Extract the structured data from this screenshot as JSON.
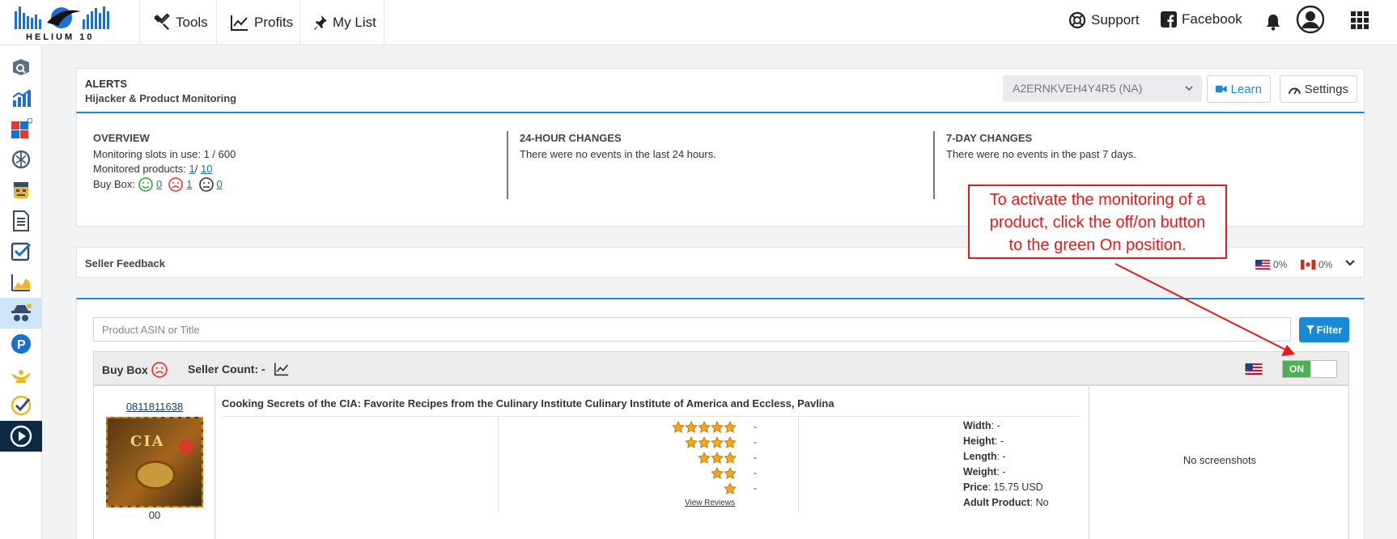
{
  "brand": {
    "logo_text": "HELIUM 10"
  },
  "nav": {
    "tabs": [
      {
        "label": "Tools",
        "icon": "tools-icon"
      },
      {
        "label": "Profits",
        "icon": "chart-line-icon"
      },
      {
        "label": "My List",
        "icon": "pin-icon"
      }
    ],
    "support": "Support",
    "facebook": "Facebook"
  },
  "header": {
    "title": "ALERTS",
    "subtitle": "Hijacker & Product Monitoring",
    "account_select": "A2ERNKVEH4Y4R5 (NA)",
    "learn_label": "Learn",
    "settings_label": "Settings"
  },
  "overview": {
    "title": "OVERVIEW",
    "slots_label": "Monitoring slots in use:",
    "slots_value": "1  / 600",
    "monitored_label": "Monitored products:",
    "monitored_used": "1",
    "monitored_sep": "/",
    "monitored_total": "10",
    "buybox_label": "Buy Box:",
    "buybox_happy": "0",
    "buybox_sad": "1",
    "buybox_neutral": "0"
  },
  "changes_24h": {
    "title": "24-HOUR CHANGES",
    "text": "There were no events in the last 24 hours."
  },
  "changes_7d": {
    "title": "7-DAY CHANGES",
    "text": "There were no events in the past 7 days."
  },
  "seller_feedback": {
    "title": "Seller Feedback",
    "us_pct": "0%",
    "ca_pct": "0%"
  },
  "products": {
    "search_placeholder": "Product ASIN or Title",
    "filter_label": "Filter",
    "buybox_label": "Buy Box",
    "seller_count_label": "Seller Count: -",
    "toggle_label": "ON",
    "row": {
      "asin": "0811811638",
      "cover_text": "CIA",
      "sub_value": "00",
      "title": "Cooking Secrets of the CIA: Favorite Recipes from the Culinary Institute Culinary Institute of America and Eccless, Pavlina",
      "ratings": [
        {
          "stars": 5,
          "count": "-"
        },
        {
          "stars": 4,
          "count": "-"
        },
        {
          "stars": 3,
          "count": "-"
        },
        {
          "stars": 2,
          "count": "-"
        },
        {
          "stars": 1,
          "count": "-"
        }
      ],
      "view_reviews": "View Reviews",
      "specs": {
        "width_label": "Width",
        "width_value": ": -",
        "height_label": "Height",
        "height_value": ": -",
        "length_label": "Length",
        "length_value": ": -",
        "weight_label": "Weight",
        "weight_value": ": -",
        "price_label": "Price",
        "price_value": ": 15.75 USD",
        "adult_label": "Adult Product",
        "adult_value": ": No"
      },
      "screenshots": "No screenshots"
    }
  },
  "callout": {
    "line1": "To activate the monitoring of a",
    "line2": "product, click the off/on button",
    "line3": "to the green On position."
  },
  "colors": {
    "accent": "#1a8ad6",
    "on_green": "#4caf50",
    "callout_red": "#e31b1b",
    "star": "#f4a61c"
  }
}
